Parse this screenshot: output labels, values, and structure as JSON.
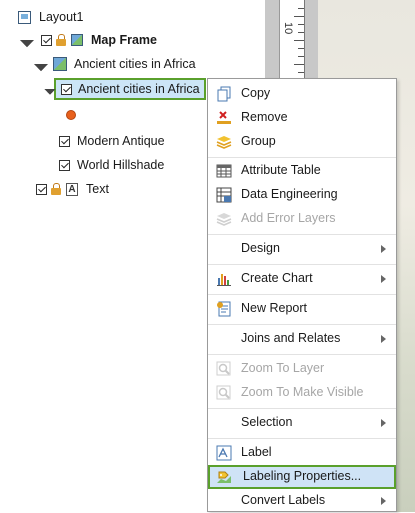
{
  "tree": {
    "layout": "Layout1",
    "map_frame": "Map Frame",
    "map": "Ancient cities in Africa",
    "layer": "Ancient cities in Africa",
    "basemap1": "Modern Antique",
    "basemap2": "World Hillshade",
    "text": "Text"
  },
  "ruler": {
    "number": "10"
  },
  "menu": {
    "items": [
      {
        "label": "Copy",
        "icon": "copy-icon",
        "enabled": true
      },
      {
        "label": "Remove",
        "icon": "remove-icon",
        "enabled": true
      },
      {
        "label": "Group",
        "icon": "group-icon",
        "enabled": true
      },
      {
        "label": "Attribute Table",
        "icon": "table-icon",
        "enabled": true
      },
      {
        "label": "Data Engineering",
        "icon": "data-engineering-icon",
        "enabled": true
      },
      {
        "label": "Add Error Layers",
        "icon": "error-layers-icon",
        "enabled": false
      },
      {
        "label": "Design",
        "submenu": true
      },
      {
        "label": "Create Chart",
        "icon": "chart-icon",
        "submenu": true
      },
      {
        "label": "New Report",
        "icon": "report-icon",
        "enabled": true
      },
      {
        "label": "Joins and Relates",
        "submenu": true
      },
      {
        "label": "Zoom To Layer",
        "icon": "zoom-layer-icon",
        "enabled": false
      },
      {
        "label": "Zoom To Make Visible",
        "icon": "zoom-visible-icon",
        "enabled": false
      },
      {
        "label": "Selection",
        "submenu": true
      },
      {
        "label": "Label",
        "icon": "label-icon",
        "enabled": true
      },
      {
        "label": "Labeling Properties...",
        "icon": "labeling-properties-icon",
        "enabled": true,
        "highlighted": true
      },
      {
        "label": "Convert Labels",
        "submenu": true
      }
    ]
  },
  "colors": {
    "highlight_border": "#5aa02c",
    "highlight_fill": "#cfe3f6"
  }
}
